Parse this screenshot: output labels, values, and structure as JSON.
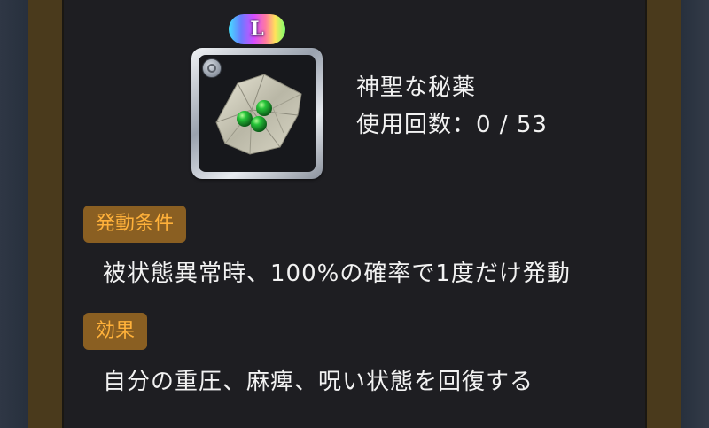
{
  "item": {
    "rarity": "L",
    "name": "神聖な秘薬",
    "uses": "使用回数：0 / 53",
    "icon": "green-pills-on-paper"
  },
  "trigger": {
    "label": "発動条件",
    "text": "被状態異常時、100%の確率で1度だけ発動"
  },
  "effect": {
    "label": "効果",
    "text": "自分の重圧、麻痺、呪い状態を回復する"
  },
  "colors": {
    "badge_bg": "#8a5f22",
    "badge_text": "#ffb13a",
    "panel_bg": "#1e1e22",
    "frame": "#4a3a1c"
  }
}
